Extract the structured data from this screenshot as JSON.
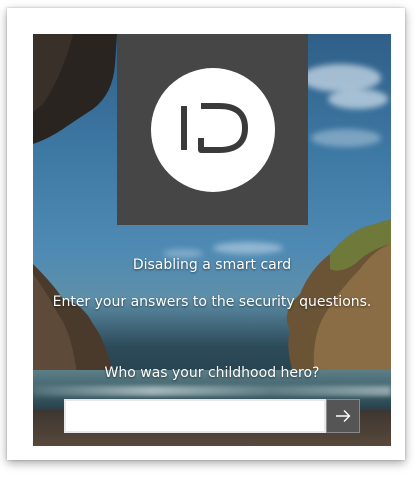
{
  "sign_in": {
    "logo_text": "ID",
    "title": "Disabling a smart card",
    "instructions": "Enter your answers to the security questions.",
    "question": "Who was your childhood hero?",
    "answer_value": "",
    "submit_icon": "arrow-right-icon"
  },
  "colors": {
    "tile": "#464646",
    "submit_button": "#555555",
    "text": "#ffffff"
  }
}
